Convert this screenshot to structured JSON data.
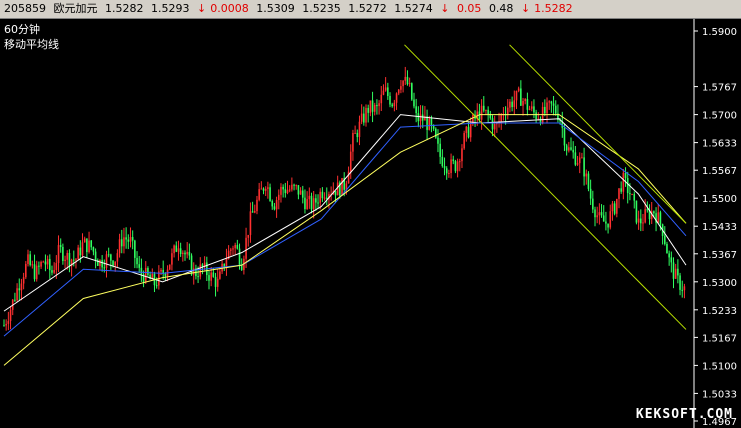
{
  "quote_bar": {
    "code": "205859",
    "name": "欧元加元",
    "open": "1.5282",
    "high": "1.5293",
    "change_arrow": "↓",
    "change": "0.0008",
    "price1": "1.5309",
    "price2": "1.5235",
    "price3": "1.5272",
    "price4": "1.5274",
    "arrow2": "↓",
    "diff": "0.05",
    "pct": "0.48",
    "arrow3": "↓",
    "last": "1.5282"
  },
  "indicator": {
    "period": "60分钟",
    "name": "移动平均线"
  },
  "watermark": "KEKSOFT.COM",
  "colors": {
    "background": "#000000",
    "up_candle": "#ff3030",
    "down_candle": "#30ff60",
    "ma_short": "#ffffff",
    "ma_mid": "#3060ff",
    "ma_long": "#ffff60",
    "channel": "#b8e000",
    "axis": "#ffffff"
  },
  "chart_data": {
    "type": "candlestick",
    "yaxis_ticks": [
      "1.5900",
      "1.5767",
      "1.5700",
      "1.5633",
      "1.5567",
      "1.5500",
      "1.5433",
      "1.5367",
      "1.5300",
      "1.5233",
      "1.5167",
      "1.5100",
      "1.5033",
      "1.4967"
    ],
    "ylim": [
      1.4967,
      1.59
    ],
    "close_path": [
      [
        0,
        1.5196
      ],
      [
        8,
        1.5245
      ],
      [
        16,
        1.5302
      ],
      [
        24,
        1.5347
      ],
      [
        32,
        1.5319
      ],
      [
        40,
        1.5352
      ],
      [
        48,
        1.5321
      ],
      [
        56,
        1.5376
      ],
      [
        64,
        1.5359
      ],
      [
        72,
        1.5352
      ],
      [
        80,
        1.5392
      ],
      [
        88,
        1.5383
      ],
      [
        96,
        1.5346
      ],
      [
        104,
        1.5357
      ],
      [
        112,
        1.5355
      ],
      [
        120,
        1.5408
      ],
      [
        128,
        1.5395
      ],
      [
        136,
        1.5324
      ],
      [
        144,
        1.5312
      ],
      [
        152,
        1.5296
      ],
      [
        160,
        1.532
      ],
      [
        168,
        1.5351
      ],
      [
        176,
        1.5395
      ],
      [
        184,
        1.536
      ],
      [
        192,
        1.532
      ],
      [
        200,
        1.5333
      ],
      [
        208,
        1.5315
      ],
      [
        216,
        1.5296
      ],
      [
        224,
        1.5359
      ],
      [
        232,
        1.5392
      ],
      [
        240,
        1.5347
      ],
      [
        248,
        1.5445
      ],
      [
        256,
        1.5496
      ],
      [
        264,
        1.554
      ],
      [
        272,
        1.5485
      ],
      [
        280,
        1.5523
      ],
      [
        288,
        1.5521
      ],
      [
        296,
        1.5521
      ],
      [
        304,
        1.5492
      ],
      [
        312,
        1.5482
      ],
      [
        320,
        1.5516
      ],
      [
        328,
        1.552
      ],
      [
        336,
        1.5522
      ],
      [
        344,
        1.5532
      ],
      [
        352,
        1.5638
      ],
      [
        360,
        1.568
      ],
      [
        368,
        1.5717
      ],
      [
        376,
        1.5711
      ],
      [
        384,
        1.5757
      ],
      [
        392,
        1.5729
      ],
      [
        400,
        1.5785
      ],
      [
        408,
        1.5771
      ],
      [
        416,
        1.569
      ],
      [
        424,
        1.569
      ],
      [
        432,
        1.566
      ],
      [
        440,
        1.56
      ],
      [
        448,
        1.5575
      ],
      [
        456,
        1.558
      ],
      [
        464,
        1.564
      ],
      [
        472,
        1.568
      ],
      [
        480,
        1.5705
      ],
      [
        488,
        1.57
      ],
      [
        496,
        1.5665
      ],
      [
        504,
        1.571
      ],
      [
        512,
        1.573
      ],
      [
        520,
        1.5745
      ],
      [
        528,
        1.572
      ],
      [
        536,
        1.57
      ],
      [
        544,
        1.57
      ],
      [
        552,
        1.572
      ],
      [
        560,
        1.57
      ],
      [
        568,
        1.562
      ],
      [
        576,
        1.56
      ],
      [
        584,
        1.558
      ],
      [
        592,
        1.55
      ],
      [
        600,
        1.545
      ],
      [
        608,
        1.544
      ],
      [
        616,
        1.548
      ],
      [
        624,
        1.5545
      ],
      [
        632,
        1.551
      ],
      [
        640,
        1.544
      ],
      [
        648,
        1.546
      ],
      [
        656,
        1.547
      ],
      [
        664,
        1.543
      ],
      [
        672,
        1.534
      ],
      [
        680,
        1.53
      ],
      [
        688,
        1.528
      ]
    ],
    "moving_averages": {
      "short": [
        [
          0,
          1.523
        ],
        [
          80,
          1.536
        ],
        [
          160,
          1.53
        ],
        [
          240,
          1.537
        ],
        [
          320,
          1.548
        ],
        [
          400,
          1.57
        ],
        [
          480,
          1.568
        ],
        [
          560,
          1.569
        ],
        [
          640,
          1.551
        ],
        [
          688,
          1.534
        ]
      ],
      "mid": [
        [
          0,
          1.517
        ],
        [
          80,
          1.533
        ],
        [
          160,
          1.532
        ],
        [
          240,
          1.534
        ],
        [
          320,
          1.545
        ],
        [
          400,
          1.567
        ],
        [
          480,
          1.568
        ],
        [
          560,
          1.568
        ],
        [
          640,
          1.554
        ],
        [
          688,
          1.541
        ]
      ],
      "long": [
        [
          0,
          1.51
        ],
        [
          80,
          1.526
        ],
        [
          160,
          1.531
        ],
        [
          240,
          1.534
        ],
        [
          320,
          1.547
        ],
        [
          400,
          1.561
        ],
        [
          480,
          1.57
        ],
        [
          560,
          1.57
        ],
        [
          640,
          1.557
        ],
        [
          688,
          1.544
        ]
      ]
    },
    "channel_lines": [
      [
        [
          404,
          1.5867
        ],
        [
          688,
          1.5186
        ]
      ],
      [
        [
          510,
          1.5867
        ],
        [
          688,
          1.544
        ]
      ]
    ]
  }
}
